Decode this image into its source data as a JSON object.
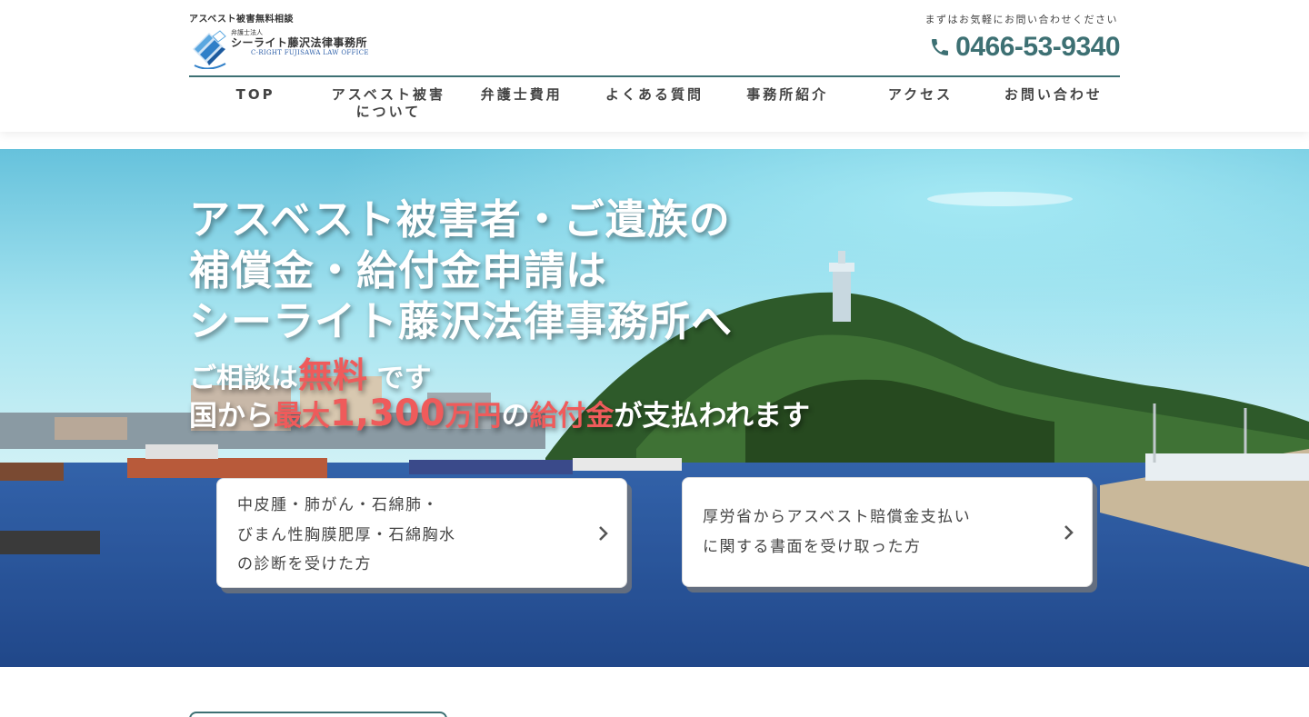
{
  "header": {
    "tagline": "アスベスト被害無料相談",
    "logo": {
      "small": "弁護士法人",
      "name": "シーライト藤沢法律事務所",
      "sub": "C-RIGHT FUJISAWA LAW OFFICE"
    },
    "contact_label": "まずはお気軽にお問い合わせください",
    "phone": "0466-53-9340",
    "phone_icon": "phone-icon"
  },
  "nav": {
    "items": [
      {
        "label": "TOP"
      },
      {
        "label": "アスベスト被害",
        "label2": "について"
      },
      {
        "label": "弁護士費用"
      },
      {
        "label": "よくある質問"
      },
      {
        "label": "事務所紹介"
      },
      {
        "label": "アクセス"
      },
      {
        "label": "お問い合わせ"
      }
    ]
  },
  "hero": {
    "headline": [
      "アスベスト被害者・ご遺族の",
      "補償金・給付金申請は",
      "シーライト藤沢法律事務所へ"
    ],
    "sub1": {
      "pre": "ご相談は",
      "em": "無料",
      "post": " です"
    },
    "sub2": {
      "pre": "国から",
      "em1a": "最大",
      "em1b": "1,300",
      "em1c": "万円",
      "mid": "の",
      "em2": "給付金",
      "post": "が支払われます"
    },
    "accent_color": "#ef5b5b"
  },
  "cards": [
    {
      "lines": [
        "中皮腫・肺がん・石綿肺・",
        "びまん性胸膜肥厚・石綿胸水",
        "の診断を受けた方"
      ]
    },
    {
      "lines": [
        "厚労省からアスベスト賠償金支払い",
        "に関する書面を受け取った方"
      ]
    }
  ],
  "colors": {
    "brand": "#3d7073",
    "accent": "#ef5b5b"
  }
}
